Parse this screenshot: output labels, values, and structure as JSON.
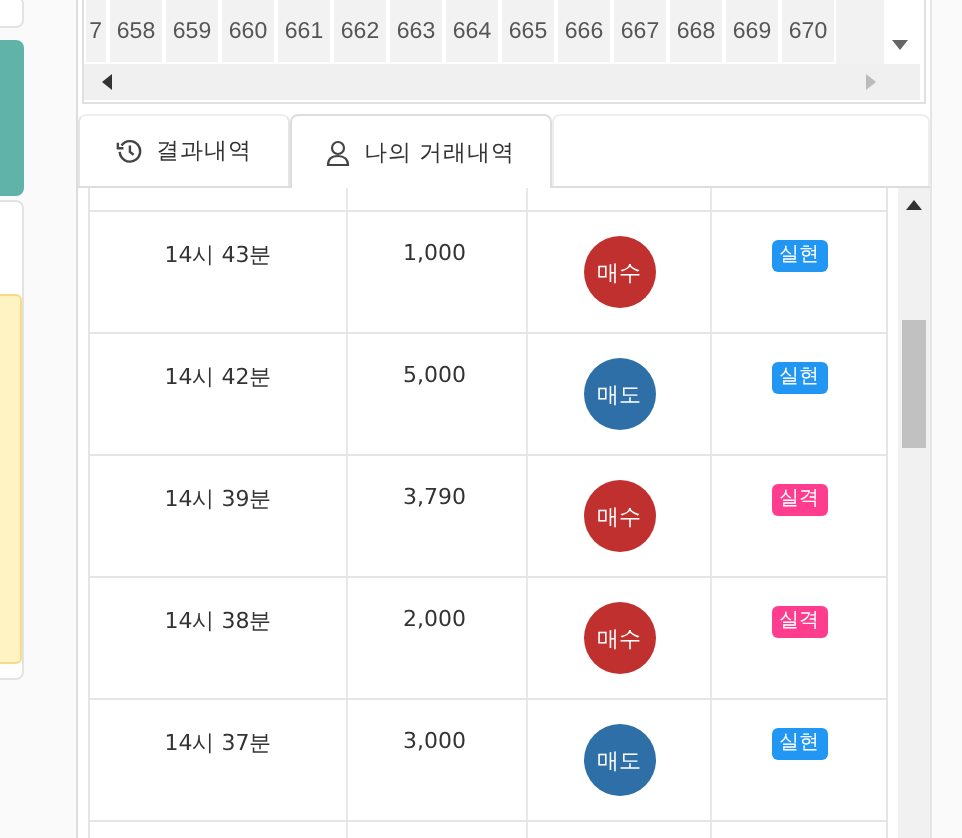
{
  "round_numbers": [
    "7",
    "658",
    "659",
    "660",
    "661",
    "662",
    "663",
    "664",
    "665",
    "666",
    "667",
    "668",
    "669",
    "670"
  ],
  "tabs": [
    {
      "label": "결과내역",
      "selected": false
    },
    {
      "label": "나의 거래내역",
      "selected": true
    }
  ],
  "trades": [
    {
      "time": "14시 43분",
      "amount": "1,000",
      "action": {
        "label": "매수",
        "color": "#c0302e"
      },
      "result": {
        "label": "실현",
        "color": "#2196f3"
      }
    },
    {
      "time": "14시 42분",
      "amount": "5,000",
      "action": {
        "label": "매도",
        "color": "#2e6fa8"
      },
      "result": {
        "label": "실현",
        "color": "#2196f3"
      }
    },
    {
      "time": "14시 39분",
      "amount": "3,790",
      "action": {
        "label": "매수",
        "color": "#c0302e"
      },
      "result": {
        "label": "실격",
        "color": "#ff3d8e"
      }
    },
    {
      "time": "14시 38분",
      "amount": "2,000",
      "action": {
        "label": "매수",
        "color": "#c0302e"
      },
      "result": {
        "label": "실격",
        "color": "#ff3d8e"
      }
    },
    {
      "time": "14시 37분",
      "amount": "3,000",
      "action": {
        "label": "매도",
        "color": "#2e6fa8"
      },
      "result": {
        "label": "실현",
        "color": "#2196f3"
      }
    }
  ]
}
